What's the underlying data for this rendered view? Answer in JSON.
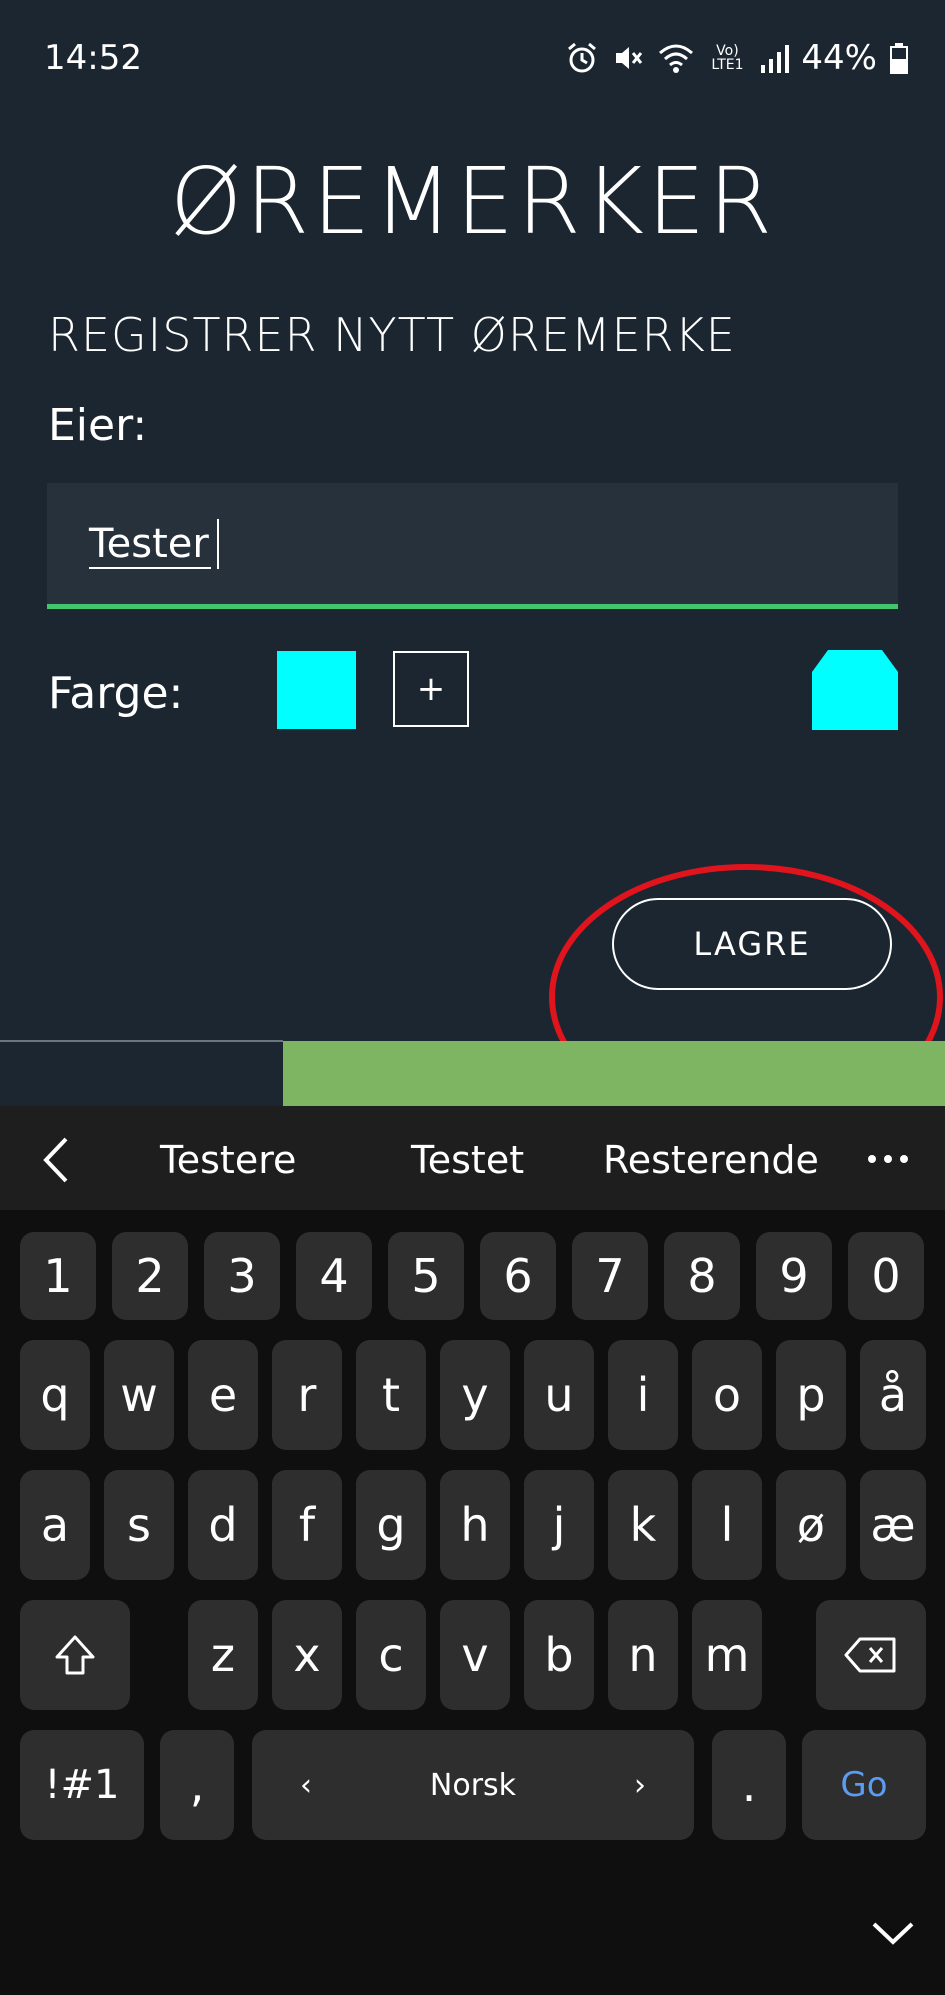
{
  "status_bar": {
    "time": "14:52",
    "volte": "Vo) LTE1",
    "battery": "44%"
  },
  "app": {
    "title": "ØREMERKER"
  },
  "form": {
    "heading": "REGISTRER NYTT ØREMERKE",
    "owner_label": "Eier:",
    "owner_value": "Tester",
    "color_label": "Farge:",
    "add_color_symbol": "+",
    "selected_color": "#00ffff",
    "save_label": "LAGRE"
  },
  "keyboard": {
    "suggestions": [
      "Testere",
      "Testet",
      "Resterende"
    ],
    "row_numbers": [
      "1",
      "2",
      "3",
      "4",
      "5",
      "6",
      "7",
      "8",
      "9",
      "0"
    ],
    "row1": [
      "q",
      "w",
      "e",
      "r",
      "t",
      "y",
      "u",
      "i",
      "o",
      "p",
      "å"
    ],
    "row2": [
      "a",
      "s",
      "d",
      "f",
      "g",
      "h",
      "j",
      "k",
      "l",
      "ø",
      "æ"
    ],
    "row3": [
      "z",
      "x",
      "c",
      "v",
      "b",
      "n",
      "m"
    ],
    "symbols_key": "!#1",
    "comma_key": ",",
    "space_label": "Norsk",
    "period_key": ".",
    "go_key": "Go"
  },
  "colors": {
    "background": "#1b2630",
    "input_bg": "#27313b",
    "accent_green": "#41c46c",
    "bar_green": "#7eb562",
    "highlight_red": "#e0141c"
  }
}
